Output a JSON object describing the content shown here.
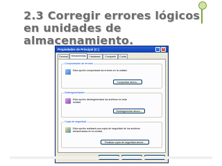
{
  "slide": {
    "title": "2.3 Corregir errores lógicos en unidades de almacenamiento."
  },
  "dialog": {
    "title": "Propiedades de Principal (C:)",
    "help_glyph": "?",
    "close_glyph": "×",
    "tabs": [
      {
        "label": "General"
      },
      {
        "label": "Herramientas"
      },
      {
        "label": "Hardware"
      },
      {
        "label": "Compartir"
      },
      {
        "label": "Cuota"
      }
    ],
    "sections": [
      {
        "title": "Comprobación de errores",
        "text": "Esta opción comprobará los errores en la unidad.",
        "button": "Comprobar ahora...",
        "icon_color": "#3a7bd5"
      },
      {
        "title": "Desfragmentación",
        "text": "Esta opción desfragmentará los archivos en esta unidad.",
        "button": "Desfragmentar ahora...",
        "icon_color": "#7a4fb5"
      },
      {
        "title": "Copia de seguridad",
        "text": "Esta opción realizará una copia de seguridad de los archivos almacenados en la unidad.",
        "button": "Realizar copia de seguridad ahora...",
        "icon_color": "#4f8fb5"
      }
    ],
    "footer": {
      "ok": "Aceptar",
      "cancel": "Cancelar",
      "apply": "Aplicar"
    }
  }
}
